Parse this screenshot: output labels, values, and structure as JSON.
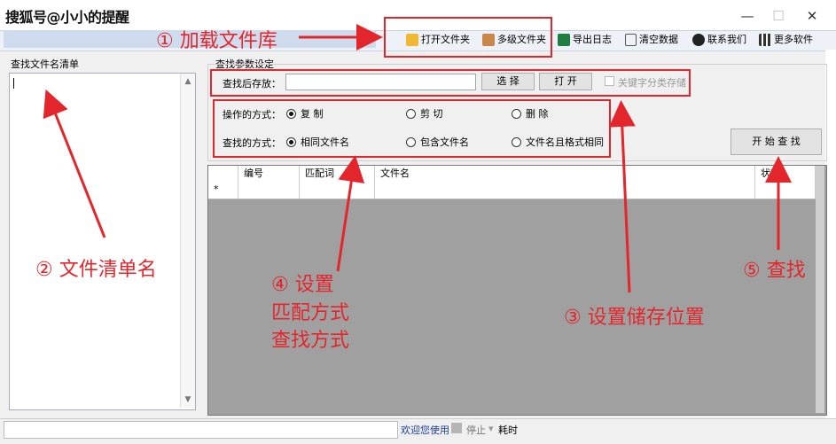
{
  "title_bar": {
    "watermark": "搜狐号@小小的提醒",
    "min": "—",
    "max": "☐",
    "close": "✕"
  },
  "toolbar": {
    "items": [
      {
        "label": "打开文件夹",
        "icon": "folder-icon",
        "color": "#f0b733"
      },
      {
        "label": "多级文件夹",
        "icon": "books-icon",
        "color": "#c9884a"
      },
      {
        "label": "导出日志",
        "icon": "excel-icon",
        "color": "#1e7d3f"
      },
      {
        "label": "清空数据",
        "icon": "clipboard-icon",
        "color": "#555555"
      },
      {
        "label": "联系我们",
        "icon": "qq-penguin-icon",
        "color": "#222222"
      },
      {
        "label": "更多软件",
        "icon": "qr-code-icon",
        "color": "#333333"
      }
    ]
  },
  "left_panel": {
    "title": "查找文件名清单",
    "list_value": ""
  },
  "settings": {
    "title": "查找参数设定",
    "save_label": "查找后存放：",
    "save_path": "",
    "select_button": "选 择",
    "open_button": "打 开",
    "keyword_checkbox": "关键字分类存储",
    "operation_label": "操作的方式：",
    "operation_options": [
      "复 制",
      "剪 切",
      "删 除"
    ],
    "search_label": "查找的方式：",
    "search_options": [
      "相同文件名",
      "包含文件名",
      "文件名且格式相同"
    ],
    "start_button": "开 始 查 找"
  },
  "grid": {
    "columns": [
      "编号",
      "匹配词",
      "文件名",
      "状态"
    ],
    "new_row_marker": "*"
  },
  "status_bar": {
    "welcome": "欢迎您使用",
    "stop": "停止",
    "elapsed": "耗时"
  },
  "annotations": {
    "a1": "① 加载文件库",
    "a2": "② 文件清单名",
    "a3": "③ 设置储存位置",
    "a4": [
      "④ 设置",
      "匹配方式",
      "查找方式"
    ],
    "a5": "⑤ 查找"
  },
  "colors": {
    "annotation_red": "#e3262c",
    "grid_gray": "#a0a0a0",
    "status_blue": "#1c3f9c"
  }
}
